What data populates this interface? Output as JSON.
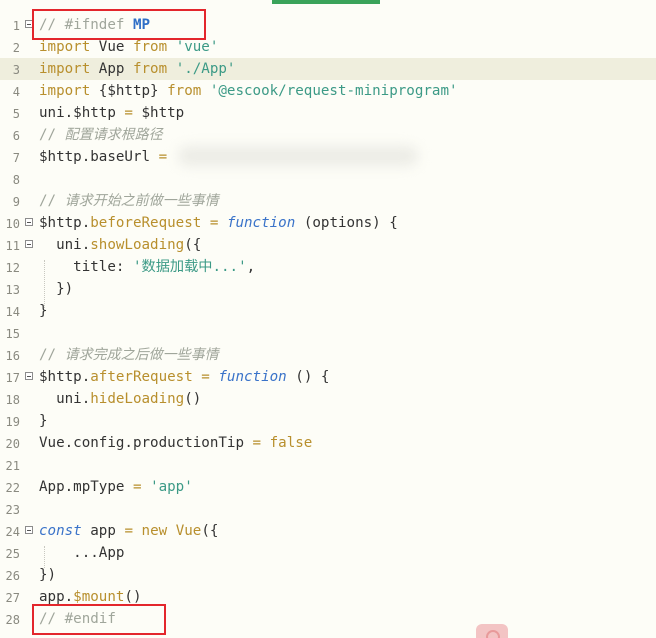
{
  "editor": {
    "lines": [
      {
        "num": "1",
        "fold": true,
        "tokens": [
          [
            "comment",
            "// #ifndef "
          ],
          [
            "bold",
            "MP"
          ]
        ]
      },
      {
        "num": "2",
        "fold": false,
        "tokens": [
          [
            "kw",
            "import"
          ],
          [
            "plain",
            " Vue "
          ],
          [
            "kw",
            "from"
          ],
          [
            "plain",
            " "
          ],
          [
            "str",
            "'vue'"
          ]
        ]
      },
      {
        "num": "3",
        "fold": false,
        "highlight": true,
        "tokens": [
          [
            "kw",
            "import"
          ],
          [
            "plain",
            " App "
          ],
          [
            "kw",
            "from"
          ],
          [
            "plain",
            " "
          ],
          [
            "str",
            "'./App'"
          ]
        ]
      },
      {
        "num": "4",
        "fold": false,
        "tokens": [
          [
            "kw",
            "import"
          ],
          [
            "plain",
            " {$http} "
          ],
          [
            "kw",
            "from"
          ],
          [
            "plain",
            " "
          ],
          [
            "str",
            "'@escook/request-miniprogram'"
          ]
        ]
      },
      {
        "num": "5",
        "fold": false,
        "tokens": [
          [
            "plain",
            "uni.$http "
          ],
          [
            "op",
            "="
          ],
          [
            "plain",
            " $http"
          ]
        ]
      },
      {
        "num": "6",
        "fold": false,
        "tokens": [
          [
            "comment",
            "// "
          ],
          [
            "cn",
            "配置请求根路径"
          ]
        ]
      },
      {
        "num": "7",
        "fold": false,
        "tokens": [
          [
            "plain",
            "$http.baseUrl "
          ],
          [
            "op",
            "="
          ]
        ]
      },
      {
        "num": "8",
        "fold": false,
        "tokens": []
      },
      {
        "num": "9",
        "fold": false,
        "tokens": [
          [
            "comment",
            "// "
          ],
          [
            "cn",
            "请求开始之前做一些事情"
          ]
        ]
      },
      {
        "num": "10",
        "fold": true,
        "tokens": [
          [
            "plain",
            "$http."
          ],
          [
            "fn",
            "beforeRequest"
          ],
          [
            "plain",
            " "
          ],
          [
            "op",
            "="
          ],
          [
            "plain",
            " "
          ],
          [
            "func",
            "function"
          ],
          [
            "plain",
            " (options) {"
          ]
        ]
      },
      {
        "num": "11",
        "fold": true,
        "tokens": [
          [
            "plain",
            "  uni."
          ],
          [
            "fn",
            "showLoading"
          ],
          [
            "plain",
            "({"
          ]
        ]
      },
      {
        "num": "12",
        "fold": false,
        "tokens": [
          [
            "plain",
            "    title: "
          ],
          [
            "str",
            "'数据加载中...'"
          ],
          [
            "plain",
            ","
          ]
        ]
      },
      {
        "num": "13",
        "fold": false,
        "tokens": [
          [
            "plain",
            "  })"
          ]
        ]
      },
      {
        "num": "14",
        "fold": false,
        "tokens": [
          [
            "plain",
            "}"
          ]
        ]
      },
      {
        "num": "15",
        "fold": false,
        "tokens": []
      },
      {
        "num": "16",
        "fold": false,
        "tokens": [
          [
            "comment",
            "// "
          ],
          [
            "cn",
            "请求完成之后做一些事情"
          ]
        ]
      },
      {
        "num": "17",
        "fold": true,
        "tokens": [
          [
            "plain",
            "$http."
          ],
          [
            "fn",
            "afterRequest"
          ],
          [
            "plain",
            " "
          ],
          [
            "op",
            "="
          ],
          [
            "plain",
            " "
          ],
          [
            "func",
            "function"
          ],
          [
            "plain",
            " () {"
          ]
        ]
      },
      {
        "num": "18",
        "fold": false,
        "tokens": [
          [
            "plain",
            "  uni."
          ],
          [
            "fn",
            "hideLoading"
          ],
          [
            "plain",
            "()"
          ]
        ]
      },
      {
        "num": "19",
        "fold": false,
        "tokens": [
          [
            "plain",
            "}"
          ]
        ]
      },
      {
        "num": "20",
        "fold": false,
        "tokens": [
          [
            "plain",
            "Vue.config.productionTip "
          ],
          [
            "op",
            "="
          ],
          [
            "plain",
            " "
          ],
          [
            "kw",
            "false"
          ]
        ]
      },
      {
        "num": "21",
        "fold": false,
        "tokens": []
      },
      {
        "num": "22",
        "fold": false,
        "tokens": [
          [
            "plain",
            "App.mpType "
          ],
          [
            "op",
            "="
          ],
          [
            "plain",
            " "
          ],
          [
            "str",
            "'app'"
          ]
        ]
      },
      {
        "num": "23",
        "fold": false,
        "tokens": []
      },
      {
        "num": "24",
        "fold": true,
        "tokens": [
          [
            "func",
            "const"
          ],
          [
            "plain",
            " app "
          ],
          [
            "op",
            "="
          ],
          [
            "plain",
            " "
          ],
          [
            "kw",
            "new"
          ],
          [
            "plain",
            " "
          ],
          [
            "kw",
            "Vue"
          ],
          [
            "plain",
            "({"
          ]
        ]
      },
      {
        "num": "25",
        "fold": false,
        "tokens": [
          [
            "plain",
            "    ...App"
          ]
        ]
      },
      {
        "num": "26",
        "fold": false,
        "tokens": [
          [
            "plain",
            "})"
          ]
        ]
      },
      {
        "num": "27",
        "fold": false,
        "tokens": [
          [
            "plain",
            "app."
          ],
          [
            "fn",
            "$mount"
          ],
          [
            "plain",
            "()"
          ]
        ]
      },
      {
        "num": "28",
        "fold": false,
        "tokens": [
          [
            "comment",
            "// #endif"
          ]
        ]
      }
    ]
  },
  "colors": {
    "background": "#fdfdf7",
    "highlight_line": "#efeedd",
    "annotation_box": "#e3262c",
    "keyword": "#b88f2d",
    "string": "#3c9a86",
    "comment": "#a0a69b",
    "function_keyword": "#3a73c9"
  }
}
